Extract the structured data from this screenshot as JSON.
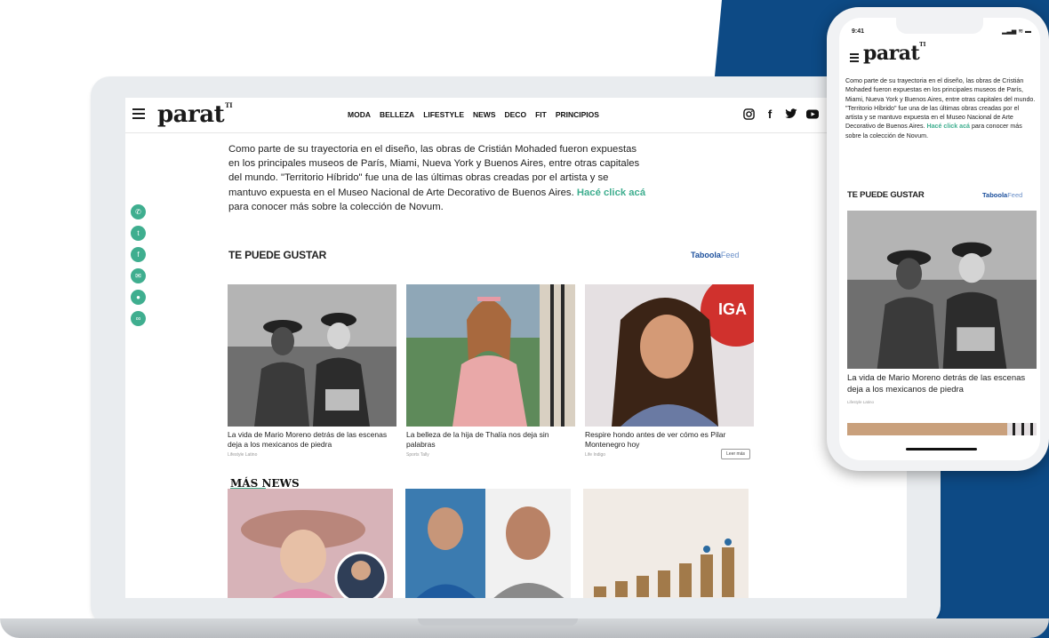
{
  "laptop": {
    "logo": "parat",
    "logo_suffix": "TI",
    "nav": [
      "MODA",
      "BELLEZA",
      "LIFESTYLE",
      "NEWS",
      "DECO",
      "FIT",
      "PRINCIPIOS"
    ],
    "social_icons": [
      "instagram-icon",
      "facebook-icon",
      "twitter-icon",
      "youtube-icon"
    ],
    "share_icons": [
      "whatsapp-icon",
      "twitter-icon",
      "facebook-icon",
      "email-icon",
      "messenger-icon",
      "link-icon"
    ],
    "article_text": "Como parte de su trayectoria en el diseño, las obras de Cristián Mohaded fueron expuestas en los principales museos de París, Miami, Nueva York y Buenos Aires, entre otras capitales del mundo. \"Territorio Híbrido\" fue una de las últimas obras creadas por el artista y se mantuvo expuesta en el Museo Nacional de Arte Decorativo de Buenos Aires. ",
    "article_link": "Hacé click acá",
    "article_tail": " para conocer más sobre la colección de Novum.",
    "section_title": "TE PUEDE GUSTAR",
    "taboola_brand": "Taboola",
    "taboola_feed": "Feed",
    "cards": [
      {
        "title": "La vida de Mario Moreno detrás de las escenas deja a los mexicanos de piedra",
        "source": "Lifestyle Latino",
        "cta": ""
      },
      {
        "title": "La belleza de la hija de Thalía nos deja sin palabras",
        "source": "Sports Tally",
        "cta": ""
      },
      {
        "title": "Respire hondo antes de ver cómo es Pilar Montenegro hoy",
        "source": "Life Indigo",
        "cta": "Leer más"
      }
    ],
    "more_title": "MÁS NEWS"
  },
  "phone": {
    "time": "9:41",
    "status_right": "▂▃▅ ≋ ▬",
    "logo": "parat",
    "logo_suffix": "TI",
    "article_text": "Como parte de su trayectoria en el diseño, las obras de Cristián Mohaded fueron expuestas en los principales museos de París, Miami, Nueva York y Buenos Aires, entre otras capitales del mundo. \"Territorio Híbrido\" fue una de las últimas obras creadas por el artista y se mantuvo expuesta en el Museo Nacional de Arte Decorativo de Buenos Aires. ",
    "article_link": "Hacé click acá",
    "article_tail": " para conocer más sobre la colección de Novum.",
    "section_title": "TE PUEDE GUSTAR",
    "taboola_brand": "Taboola",
    "taboola_feed": "Feed",
    "card_title": "La vida de Mario Moreno detrás de las escenas deja a los mexicanos de piedra",
    "card_source": "Lifestyle Latino"
  },
  "colors": {
    "accent": "#3fae8f",
    "navy": "#0d4a85",
    "taboola": "#1b4f9c"
  }
}
